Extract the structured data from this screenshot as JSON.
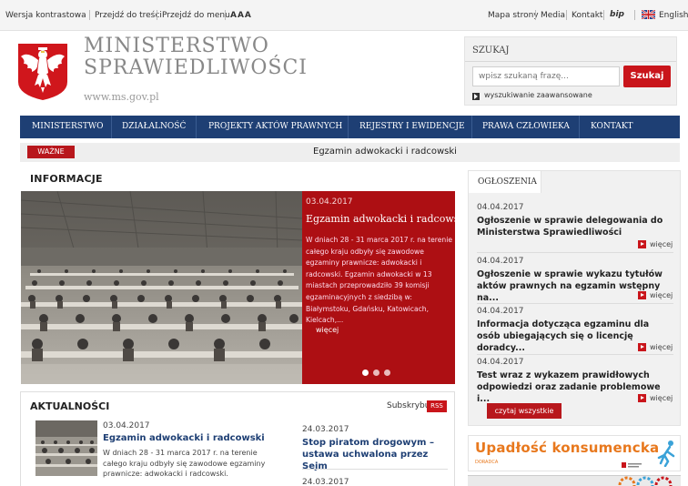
{
  "topbar": {
    "left_links": [
      "Wersja kontrastowa",
      "Przejdź do treści",
      "Przejdź do menu"
    ],
    "font_size_label": "AAA",
    "right_links": [
      "Mapa strony",
      "Media",
      "Kontakt"
    ],
    "bip_label": "bip",
    "english_label": "English"
  },
  "header": {
    "title_line1": "MINISTERSTWO",
    "title_line2": "SPRAWIEDLIWOŚCI",
    "url": "www.ms.gov.pl"
  },
  "search": {
    "heading": "SZUKAJ",
    "placeholder": "wpisz szukaną frazę...",
    "button": "Szukaj",
    "advanced": "wyszukiwanie zaawansowane"
  },
  "nav": {
    "items": [
      "MINISTERSTWO",
      "DZIAŁALNOŚĆ",
      "PROJEKTY AKTÓW PRAWNYCH",
      "REJESTRY I EWIDENCJE",
      "PRAWA CZŁOWIEKA",
      "KONTAKT"
    ]
  },
  "important": {
    "badge": "WAŻNE",
    "text": "Egzamin adwokacki i radcowski"
  },
  "informacje": {
    "heading": "INFORMACJE",
    "slide": {
      "date": "03.04.2017",
      "title": "Egzamin adwokacki i radcowski",
      "text": "W dniach 28 - 31 marca 2017 r. na terenie całego kraju odbyły się zawodowe egzaminy prawnicze: adwokacki i radcowski. Egzamin adwokacki w 13 miastach przeprowadziło 39 komisji egzaminacyjnych z siedzibą w: Białymstoku, Gdańsku, Katowicach, Kielcach,...",
      "more": "więcej"
    }
  },
  "aktualnosci": {
    "heading": "AKTUALNOŚCI",
    "subscribe": "Subskrybuj",
    "rss": "RSS",
    "items": [
      {
        "date": "03.04.2017",
        "title": "Egzamin adwokacki i radcowski",
        "text": "W dniach 28 - 31 marca 2017 r. na terenie całego kraju odbyły się zawodowe egzaminy prawnicze: adwokacki i radcowski."
      },
      {
        "date": "24.03.2017",
        "title": "Stop piratom drogowym – ustawa uchwalona przez Sejm"
      },
      {
        "date": "24.03.2017"
      }
    ]
  },
  "ogloszenia": {
    "heading": "OGŁOSZENIA",
    "items": [
      {
        "date": "04.04.2017",
        "title": "Ogłoszenie w sprawie delegowania do Ministerstwa Sprawiedliwości",
        "more": "więcej"
      },
      {
        "date": "04.04.2017",
        "title": "Ogłoszenie w sprawie wykazu tytułów aktów prawnych na egzamin wstępny na...",
        "more": "więcej"
      },
      {
        "date": "04.04.2017",
        "title": "Informacja dotycząca egzaminu dla osób ubiegających się o licencję doradcy...",
        "more": "więcej"
      },
      {
        "date": "04.04.2017",
        "title": "Test wraz z wykazem prawidłowych odpowiedzi oraz zadanie problemowe i...",
        "more": "więcej"
      }
    ],
    "read_all": "czytaj wszystkie"
  },
  "banners": {
    "upadlosc": "Upadłość konsumencka",
    "upadlosc_sub": "DORADCA"
  },
  "colors": {
    "brand_red": "#c9151b",
    "nav_blue": "#1e3f74"
  }
}
